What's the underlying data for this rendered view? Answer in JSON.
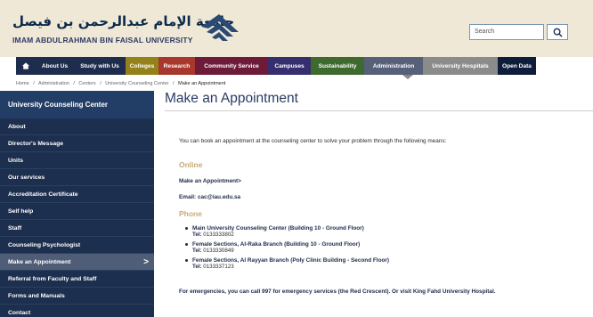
{
  "header": {
    "logo_arabic": "جامعة الإمام عبدالرحمن بن فيصل",
    "logo_english": "IMAM ABDULRAHMAN BIN FAISAL UNIVERSITY",
    "search_placeholder": "Search"
  },
  "nav": {
    "items": [
      {
        "label": "",
        "icon": "home-icon",
        "color": "#1e2d4d"
      },
      {
        "label": "About Us",
        "color": "#1e2d4d"
      },
      {
        "label": "Study with Us",
        "color": "#1e2d4d"
      },
      {
        "label": "Colleges",
        "color": "#95811a"
      },
      {
        "label": "Research",
        "color": "#a8372d"
      },
      {
        "label": "Community Service",
        "color": "#6e1b3a"
      },
      {
        "label": "Campuses",
        "color": "#352f70"
      },
      {
        "label": "Sustainability",
        "color": "#3e6a2f"
      },
      {
        "label": "Administration",
        "color": "#566079"
      },
      {
        "label": "University Hospitals",
        "color": "#8b8b8b"
      },
      {
        "label": "Open Data",
        "color": "#0e1e3a"
      }
    ]
  },
  "breadcrumb": [
    "Home",
    "/",
    "Administration",
    "/",
    "Centers",
    "/",
    "University Counseling Center",
    "/",
    "Make an Appointment"
  ],
  "sidebar": {
    "header": "University Counseling Center",
    "items": [
      {
        "label": "About"
      },
      {
        "label": "Director's Message"
      },
      {
        "label": "Units"
      },
      {
        "label": "Our services"
      },
      {
        "label": "Accreditation Certificate"
      },
      {
        "label": "Self help"
      },
      {
        "label": "Staff"
      },
      {
        "label": "Counseling Psychologist"
      },
      {
        "label": "Make an Appointment",
        "active": true,
        "arrow": ">"
      },
      {
        "label": "Referral from Faculty and Staff"
      },
      {
        "label": "Forms and Manuals"
      },
      {
        "label": "Contact"
      }
    ]
  },
  "content": {
    "title": "Make an Appointment",
    "intro": "You can book an appointment at the counseling center to solve your problem through the following means:",
    "online_heading": "Online",
    "appointment_link": "Make an Appointment>",
    "email": "Email: cac@iau.edu.sa",
    "phone_heading": "Phone",
    "tel_label": "Tel:",
    "phones": [
      {
        "name": "Main University Counseling Center (Building 10 - Ground Floor)",
        "tel": "0133333802"
      },
      {
        "name": "Female Sections, Al-Raka Branch (Building 10 - Ground Floor)",
        "tel": "0133330849"
      },
      {
        "name": "Female Sections, Al Rayyan Branch (Poly Clinic Building - Second Floor)",
        "tel": "0133337123"
      }
    ],
    "emergency": "For emergencies, you can call 997 for emergency services (the Red Crescent). Or visit King Fahd University Hospital."
  }
}
